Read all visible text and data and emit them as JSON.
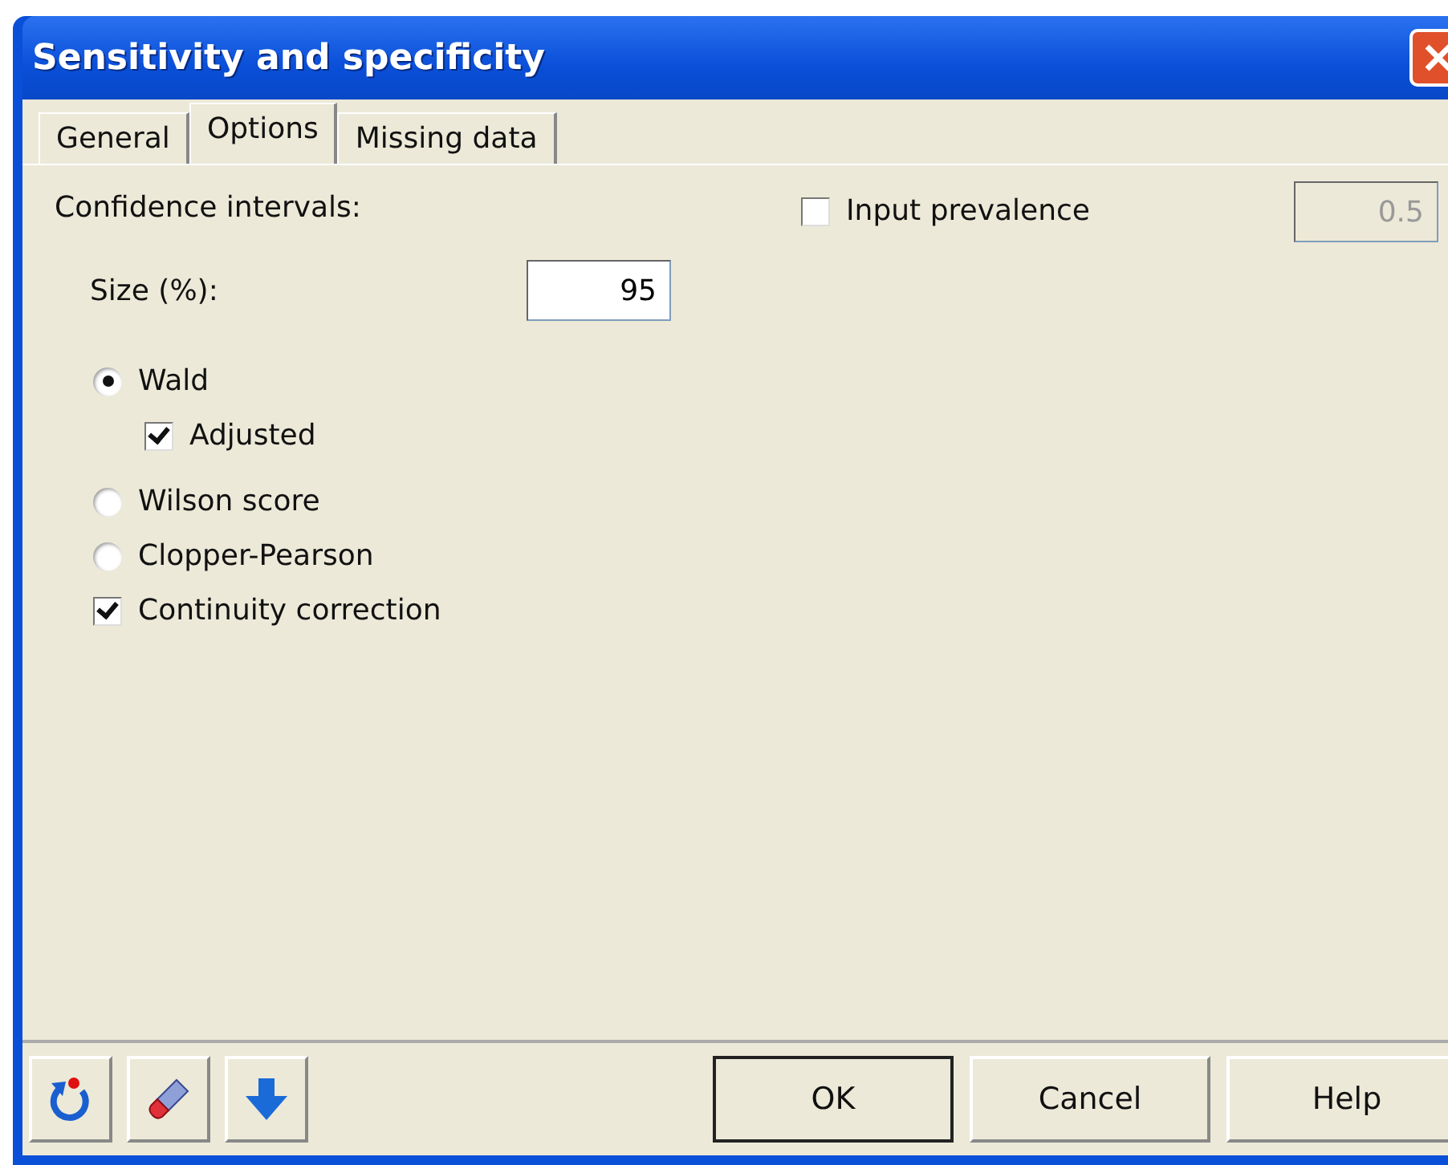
{
  "window": {
    "title": "Sensitivity and specificity"
  },
  "tabs": [
    {
      "label": "General",
      "selected": false
    },
    {
      "label": "Options",
      "selected": true
    },
    {
      "label": "Missing data",
      "selected": false
    }
  ],
  "confidence_intervals": {
    "label": "Confidence intervals:",
    "size": {
      "label": "Size (%):",
      "value": "95"
    },
    "options": [
      {
        "kind": "radio",
        "label": "Wald",
        "selected": true,
        "children": [
          {
            "kind": "checkbox",
            "label": "Adjusted",
            "checked": true
          }
        ]
      },
      {
        "kind": "radio",
        "label": "Wilson score",
        "selected": false
      },
      {
        "kind": "radio",
        "label": "Clopper-Pearson",
        "selected": false
      },
      {
        "kind": "checkbox",
        "label": "Continuity correction",
        "checked": true
      }
    ]
  },
  "prevalence": {
    "label": "Input prevalence",
    "checked": false,
    "value": "0.5",
    "disabled": true
  },
  "buttons": [
    {
      "label": "OK",
      "default": true
    },
    {
      "label": "Cancel",
      "default": false
    },
    {
      "label": "Help",
      "default": false
    }
  ]
}
